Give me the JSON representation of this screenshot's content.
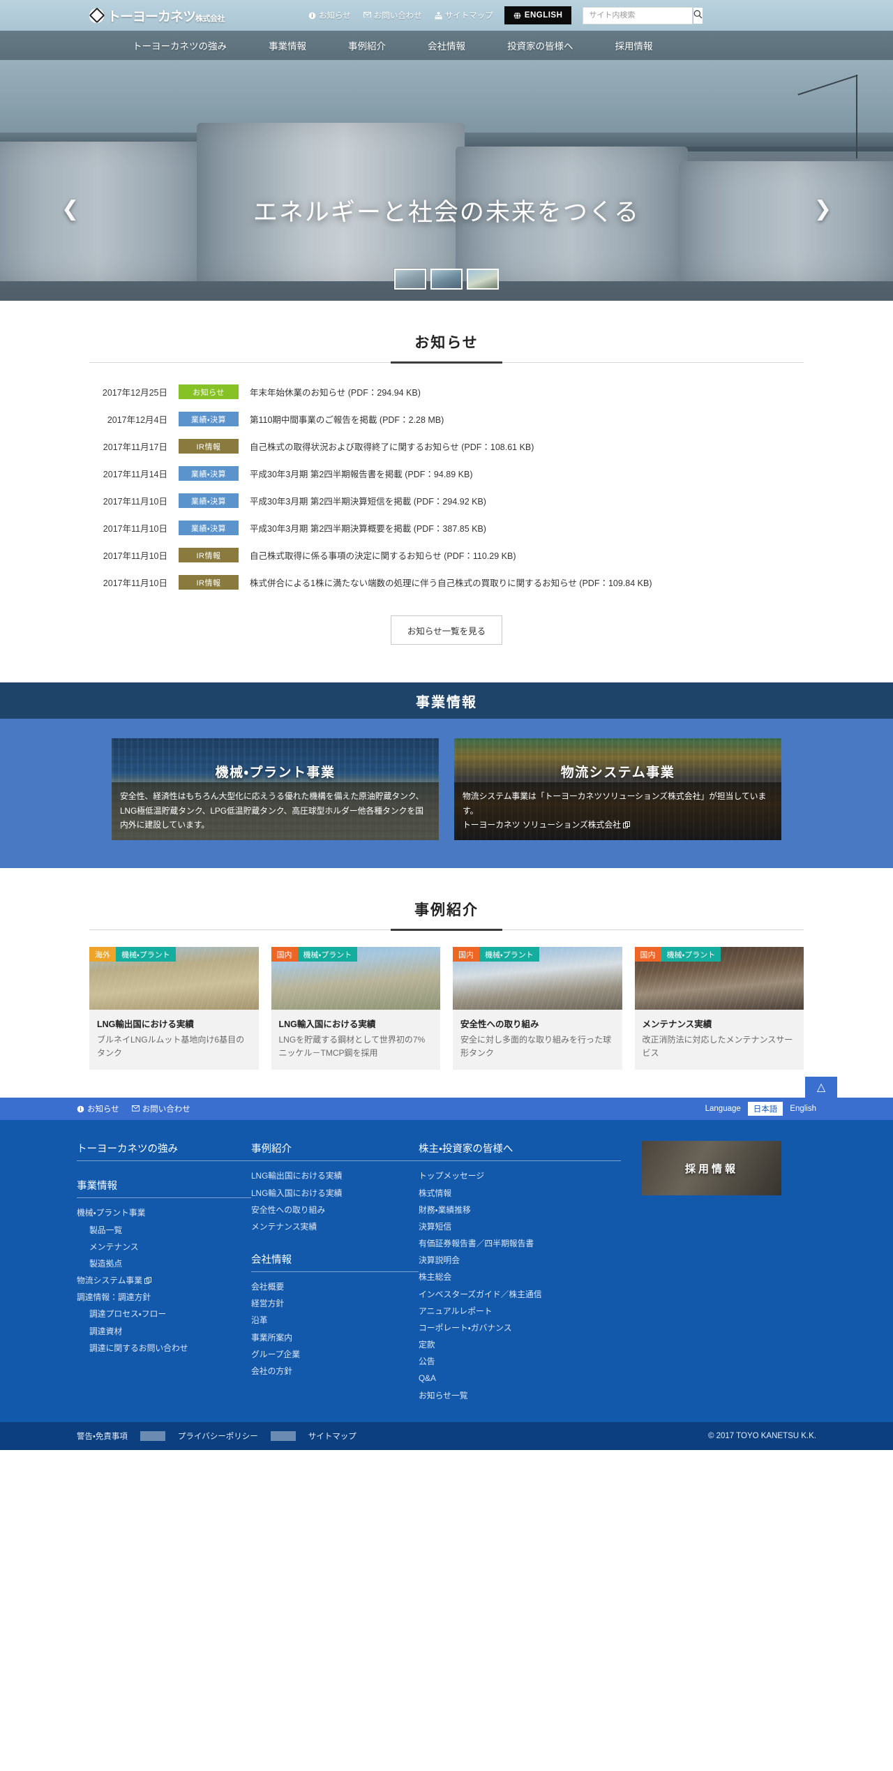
{
  "header": {
    "logo_main": "トーヨーカネツ",
    "logo_sub": "株式会社",
    "logo_icon": "toyo-kanetsu-logo-icon",
    "links": [
      {
        "label": "お知らせ",
        "icon": "info-icon"
      },
      {
        "label": "お問い合わせ",
        "icon": "mail-icon"
      },
      {
        "label": "サイトマップ",
        "icon": "sitemap-icon"
      }
    ],
    "english_button": "ENGLISH",
    "english_icon": "globe-icon",
    "search_placeholder": "サイト内検索",
    "search_value": "",
    "search_icon": "search-icon"
  },
  "gnav": {
    "items": [
      {
        "label": "トーヨーカネツの強み"
      },
      {
        "label": "事業情報"
      },
      {
        "label": "事例紹介"
      },
      {
        "label": "会社情報"
      },
      {
        "label": "投資家の皆様へ"
      },
      {
        "label": "採用情報"
      }
    ]
  },
  "hero": {
    "title": "エネルギーと社会の未来をつくる",
    "prev_icon": "chevron-left-icon",
    "next_icon": "chevron-right-icon",
    "thumbs": [
      "slide-1",
      "slide-2",
      "slide-3"
    ]
  },
  "news": {
    "heading": "お知らせ",
    "items": [
      {
        "date": "2017年12月25日",
        "badge": "お知らせ",
        "badge_type": "news",
        "title": "年末年始休業のお知らせ (PDF：294.94 KB)"
      },
      {
        "date": "2017年12月4日",
        "badge": "業績・決算",
        "badge_type": "result",
        "title": "第110期中間事業のご報告を掲載 (PDF：2.28 MB)"
      },
      {
        "date": "2017年11月17日",
        "badge": "IR情報",
        "badge_type": "ir",
        "title": "自己株式の取得状況および取得終了に関するお知らせ (PDF：108.61 KB)"
      },
      {
        "date": "2017年11月14日",
        "badge": "業績・決算",
        "badge_type": "result",
        "title": "平成30年3月期 第2四半期報告書を掲載 (PDF：94.89 KB)"
      },
      {
        "date": "2017年11月10日",
        "badge": "業績・決算",
        "badge_type": "result",
        "title": "平成30年3月期 第2四半期決算短信を掲載 (PDF：294.92 KB)"
      },
      {
        "date": "2017年11月10日",
        "badge": "業績・決算",
        "badge_type": "result",
        "title": "平成30年3月期 第2四半期決算概要を掲載 (PDF：387.85 KB)"
      },
      {
        "date": "2017年11月10日",
        "badge": "IR情報",
        "badge_type": "ir",
        "title": "自己株式取得に係る事項の決定に関するお知らせ (PDF：110.29 KB)"
      },
      {
        "date": "2017年11月10日",
        "badge": "IR情報",
        "badge_type": "ir",
        "title": "株式併合による1株に満たない端数の処理に伴う自己株式の買取りに関するお知らせ (PDF：109.84 KB)"
      }
    ],
    "more_label": "お知らせ一覧を見る"
  },
  "business": {
    "heading": "事業情報",
    "cards": [
      {
        "title": "機械・プラント事業",
        "desc": "安全性、経済性はもちろん大型化に応えうる優れた機構を備えた原油貯蔵タンク、LNG極低温貯蔵タンク、LPG低温貯蔵タンク、高圧球型ホルダー他各種タンクを国内外に建設しています。",
        "image": "plant-aerial-photo"
      },
      {
        "title": "物流システム事業",
        "desc": "物流システム事業は「トーヨーカネツソリューションズ株式会社」が担当しています。",
        "link_label": "トーヨーカネツ ソリューションズ株式会社",
        "link_icon": "external-link-icon",
        "image": "conveyor-system-photo"
      }
    ]
  },
  "cases": {
    "heading": "事例紹介",
    "items": [
      {
        "tag_region": "海外",
        "tag_region_type": "kaigai",
        "tag_kind": "機械・プラント",
        "title": "LNG輸出国における実績",
        "desc": "ブルネイLNGルムット基地向け6基目のタンク",
        "image": "lng-export-tank-photo"
      },
      {
        "tag_region": "国内",
        "tag_region_type": "kokunai",
        "tag_kind": "機械・プラント",
        "title": "LNG輸入国における実績",
        "desc": "LNGを貯蔵する鋼材として世界初の7%ニッケル－TMCP鋼を採用",
        "image": "lng-import-tank-photo"
      },
      {
        "tag_region": "国内",
        "tag_region_type": "kokunai",
        "tag_kind": "機械・プラント",
        "title": "安全性への取り組み",
        "desc": "安全に対し多面的な取り組みを行った球形タンク",
        "image": "spherical-tank-photo"
      },
      {
        "tag_region": "国内",
        "tag_region_type": "kokunai",
        "tag_kind": "機械・プラント",
        "title": "メンテナンス実績",
        "desc": "改正消防法に対応したメンテナンスサービス",
        "image": "maintenance-workers-photo"
      }
    ]
  },
  "footer": {
    "to_top_icon": "chevron-up-icon",
    "util_links": [
      {
        "label": "お知らせ",
        "icon": "info-icon"
      },
      {
        "label": "お問い合わせ",
        "icon": "mail-icon"
      }
    ],
    "language_label": "Language",
    "language_current": "日本語",
    "language_other": "English",
    "col1": {
      "head1": "トーヨーカネツの強み",
      "head2": "事業情報",
      "links": [
        {
          "label": "機械・プラント事業",
          "indent": false
        },
        {
          "label": "製品一覧",
          "indent": true
        },
        {
          "label": "メンテナンス",
          "indent": true
        },
        {
          "label": "製造拠点",
          "indent": true
        },
        {
          "label": "物流システム事業",
          "indent": false,
          "external": true
        },
        {
          "label": "調達情報：調達方針",
          "indent": false
        },
        {
          "label": "調達プロセス・フロー",
          "indent": true
        },
        {
          "label": "調達資材",
          "indent": true
        },
        {
          "label": "調達に関するお問い合わせ",
          "indent": true
        }
      ]
    },
    "col2": {
      "head1": "事例紹介",
      "links1": [
        {
          "label": "LNG輸出国における実績"
        },
        {
          "label": "LNG輸入国における実績"
        },
        {
          "label": "安全性への取り組み"
        },
        {
          "label": "メンテナンス実績"
        }
      ],
      "head2": "会社情報",
      "links2": [
        {
          "label": "会社概要"
        },
        {
          "label": "経営方針"
        },
        {
          "label": "沿革"
        },
        {
          "label": "事業所案内"
        },
        {
          "label": "グループ企業"
        },
        {
          "label": "会社の方針"
        }
      ]
    },
    "col3": {
      "head1": "株主・投資家の皆様へ",
      "links": [
        {
          "label": "トップメッセージ"
        },
        {
          "label": "株式情報"
        },
        {
          "label": "財務・業績推移"
        },
        {
          "label": "決算短信"
        },
        {
          "label": "有価証券報告書／四半期報告書"
        },
        {
          "label": "決算説明会"
        },
        {
          "label": "株主総会"
        },
        {
          "label": "インベスターズガイド／株主通信"
        },
        {
          "label": "アニュアルレポート"
        },
        {
          "label": "コーポレート・ガバナンス"
        },
        {
          "label": "定款"
        },
        {
          "label": "公告"
        },
        {
          "label": "Q&A"
        },
        {
          "label": "お知らせ一覧"
        }
      ]
    },
    "recruit": {
      "label": "採用情報",
      "image": "recruit-worker-photo"
    },
    "bottom_links": [
      "警告・免責事項",
      "プライバシーポリシー",
      "サイトマップ"
    ],
    "copyright": "© 2017 TOYO KANETSU K.K."
  },
  "colors": {
    "brand_blue": "#1258ab",
    "nav_blue": "#3a6fd0",
    "biz_band": "#1e4469",
    "biz_body": "#4a79c4",
    "badge_news": "#86c226",
    "badge_result": "#5b93cd",
    "badge_ir": "#8a7a3d",
    "tag_kaigai": "#eda429",
    "tag_kokunai": "#ef6526",
    "tag_kind": "#14ad9e",
    "footer_bottom": "#0b3f80"
  }
}
